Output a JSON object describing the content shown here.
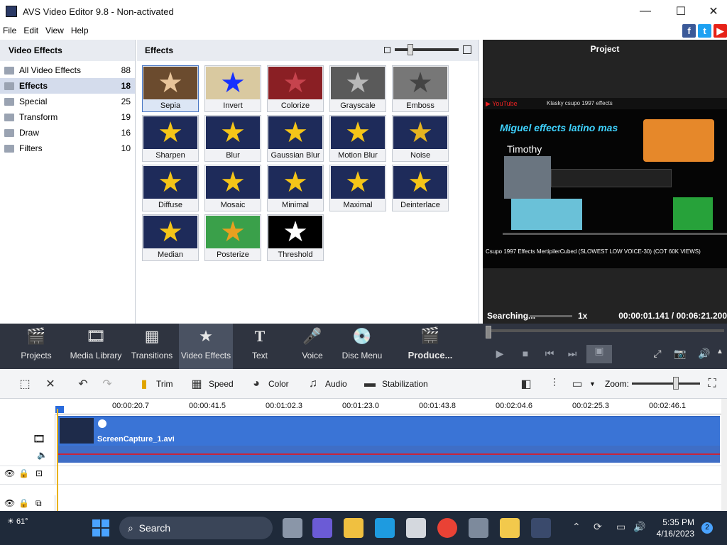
{
  "window": {
    "title": "AVS Video Editor 9.8 - Non-activated",
    "minimize": "—",
    "maximize": "☐",
    "close": "✕"
  },
  "menu": [
    "File",
    "Edit",
    "View",
    "Help"
  ],
  "categories": {
    "header": "Video Effects",
    "items": [
      {
        "label": "All Video Effects",
        "count": "88"
      },
      {
        "label": "Effects",
        "count": "18"
      },
      {
        "label": "Special",
        "count": "25"
      },
      {
        "label": "Transform",
        "count": "19"
      },
      {
        "label": "Draw",
        "count": "16"
      },
      {
        "label": "Filters",
        "count": "10"
      }
    ]
  },
  "effects": {
    "header": "Effects",
    "tiles": [
      "Sepia",
      "Invert",
      "Colorize",
      "Grayscale",
      "Emboss",
      "Sharpen",
      "Blur",
      "Gaussian Blur",
      "Motion Blur",
      "Noise",
      "Diffuse",
      "Mosaic",
      "Minimal",
      "Maximal",
      "Deinterlace",
      "Median",
      "Posterize",
      "Threshold"
    ]
  },
  "project": {
    "header": "Project",
    "status": "Searching...",
    "speed": "1x",
    "timecode": "00:00:01.141 / 00:06:21.200",
    "preview": {
      "yt_title": "Klasky csupo 1997 effects",
      "banner": "Miguel effects latino mas",
      "name": "Timothy",
      "caption": "Csupo 1997 Effects MertipilerCubed (SLOWEST LOW VOICE-30) (COT 60K VIEWS)"
    }
  },
  "toolbar": {
    "items": [
      "Projects",
      "Media Library",
      "Transitions",
      "Video Effects",
      "Text",
      "Voice",
      "Disc Menu",
      "Produce..."
    ]
  },
  "edit": {
    "trim": "Trim",
    "speed": "Speed",
    "color": "Color",
    "audio": "Audio",
    "stabilization": "Stabilization",
    "zoom": "Zoom:"
  },
  "timeline": {
    "ticks": [
      "00:00:20.7",
      "00:00:41.5",
      "00:01:02.3",
      "00:01:23.0",
      "00:01:43.8",
      "00:02:04.6",
      "00:02:25.3",
      "00:02:46.1"
    ],
    "clip": "ScreenCapture_1.avi"
  },
  "taskbar": {
    "temp": "61°",
    "search": "Search",
    "time": "5:35 PM",
    "date": "4/16/2023",
    "notifications": "2"
  }
}
